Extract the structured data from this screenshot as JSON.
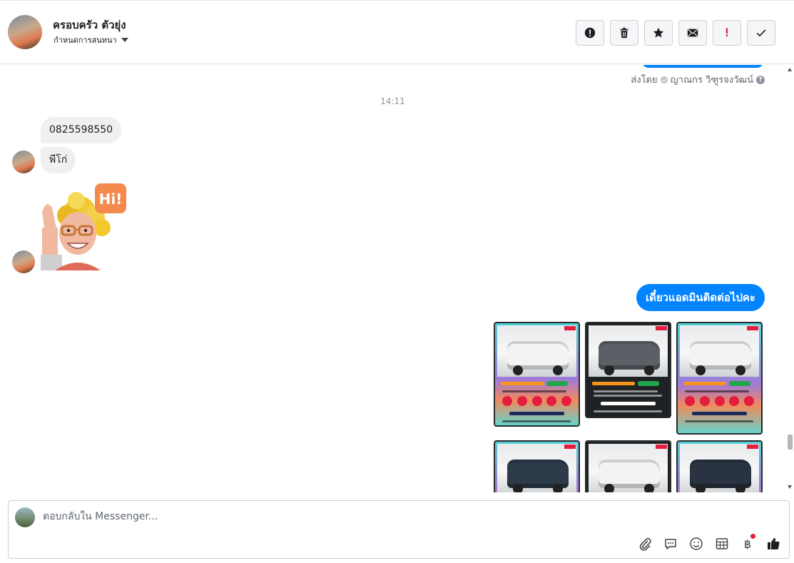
{
  "header": {
    "name": "ครอบครัว ตัวยุ่ง",
    "subtitle": "กำหนดการสนทนา",
    "actions": [
      {
        "name": "report-icon"
      },
      {
        "name": "trash-icon"
      },
      {
        "name": "star-icon"
      },
      {
        "name": "envelope-icon"
      },
      {
        "name": "exclamation-icon",
        "label": "!"
      },
      {
        "name": "check-icon"
      }
    ]
  },
  "conversation": {
    "sent_by_label": "ส่งโดย",
    "sent_by_name": "ญาณกร วิฑูรจงวัฒน์",
    "help_mark": "?",
    "timestamp": "14:11",
    "incoming": [
      {
        "text": "0825598550"
      },
      {
        "text": "พีโก่"
      }
    ],
    "sticker": {
      "text": "Hi!"
    },
    "outgoing": [
      {
        "text": "เดี๋ยวแอดมินติดต่อไปคะ"
      }
    ],
    "car_cards": [
      {
        "style": "grad",
        "truck_color": "#f3f3f3"
      },
      {
        "style": "dark",
        "truck_color": "#5b6066"
      },
      {
        "style": "grad",
        "truck_color": "#f3f3f3"
      },
      {
        "style": "grad",
        "truck_color": "#2c3a4a"
      },
      {
        "style": "dark",
        "truck_color": "#f3f3f3"
      },
      {
        "style": "grad",
        "truck_color": "#2a3342"
      }
    ]
  },
  "composer": {
    "placeholder": "ตอบกลับใน Messenger...",
    "baht_symbol": "฿"
  },
  "colors": {
    "accent": "#0084ff",
    "incoming_bubble": "#f1f0f0"
  }
}
